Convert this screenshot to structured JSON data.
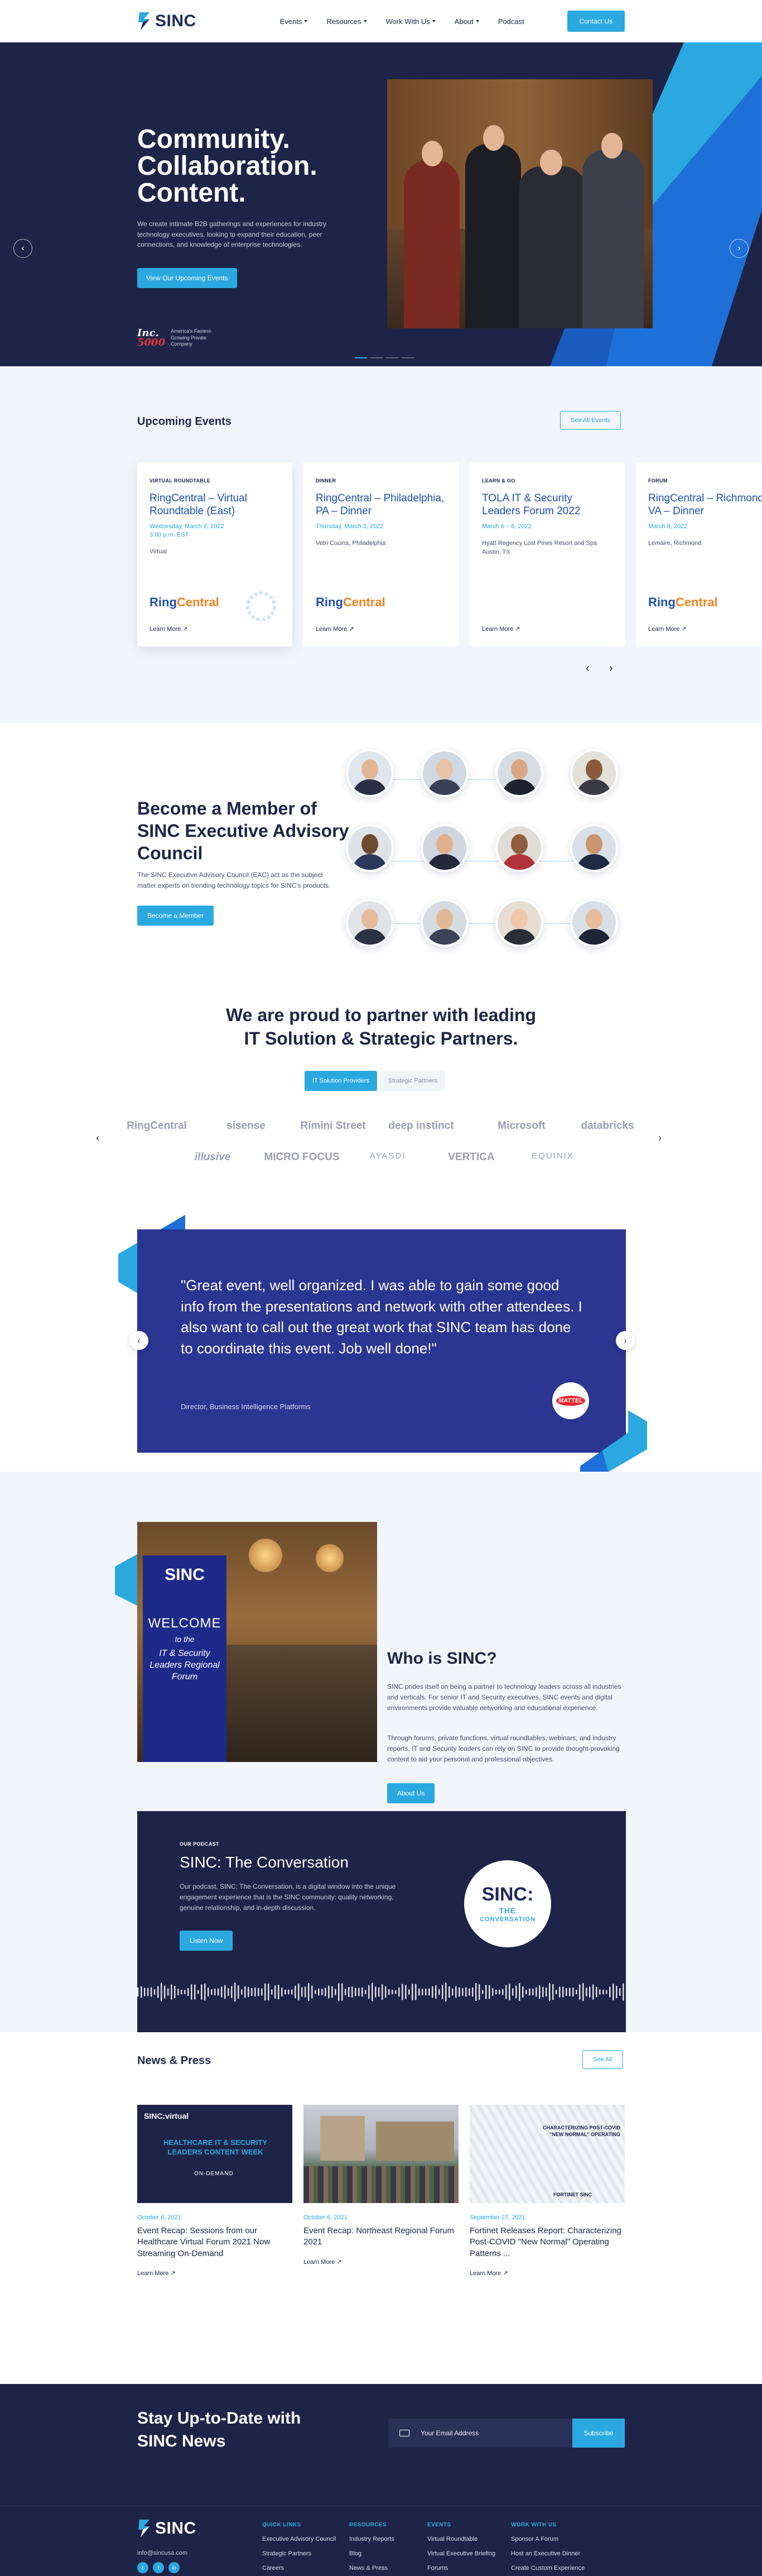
{
  "header": {
    "logo_text": "SINC",
    "nav": [
      "Events",
      "Resources",
      "Work With Us",
      "About",
      "Podcast"
    ],
    "nav_has_caret": [
      true,
      true,
      true,
      true,
      false
    ],
    "cta": "Contact Us"
  },
  "hero": {
    "title_lines": [
      "Community.",
      "Collaboration.",
      "Content."
    ],
    "description": "We create intimate B2B gatherings and experiences for industry technology executives, looking to expand their education, peer connections, and knowledge of enterprise technologies.",
    "cta": "View Our Upcoming Events",
    "inc_badge_top": "Inc.",
    "inc_badge_bottom": "5000",
    "inc_text": "America's Fastest-Growing Private Company",
    "slide_count": 4,
    "active_slide": 1
  },
  "events": {
    "title": "Upcoming Events",
    "see_all": "See All Events",
    "cards": [
      {
        "type": "VIRTUAL ROUNDTABLE",
        "name": "RingCentral – Virtual Roundtable (East)",
        "date": "Wednesday, March 2, 2022\n3:00 p.m. EST",
        "location": "Virtual",
        "brand": "RingCentral",
        "more": "Learn More"
      },
      {
        "type": "DINNER",
        "name": "RingCentral – Philadelphia, PA – Dinner",
        "date": "Thursday, March 3, 2022",
        "location": "Vetri Cucina, Philadelphia",
        "brand": "RingCentral",
        "more": "Learn More"
      },
      {
        "type": "LEARN & GO",
        "name": "TOLA IT & Security Leaders Forum 2022",
        "date": "March 6 – 8, 2022",
        "location": "Hyatt Regency Lost Pines Resort and Spa\nAustin, TX",
        "brand": "",
        "more": "Learn More"
      },
      {
        "type": "FORUM",
        "name": "RingCentral – Richmond, VA – Dinner",
        "date": "March 8, 2022",
        "location": "Lemaire, Richmond",
        "brand": "RingCentral",
        "more": "Learn More"
      }
    ]
  },
  "member": {
    "title": "Become a Member of SINC Executive Advisory Council",
    "description": "The SINC Executive Advisory Council (EAC) act as the subject matter experts on trending technology topics for SINC's products.",
    "cta": "Become a Member"
  },
  "partners": {
    "title_line1": "We are proud to partner with leading",
    "title_line2": "IT Solution & Strategic Partners.",
    "tabs": [
      "IT Solution Providers",
      "Strategic Partners"
    ],
    "row1": [
      "RingCentral",
      "sisense",
      "Rimini Street",
      "deep instinct",
      "Microsoft",
      "databricks"
    ],
    "row2": [
      "illusive",
      "MICRO FOCUS",
      "AYASDI",
      "VERTICA",
      "EQUINIX"
    ]
  },
  "testimonial": {
    "quote": "\"Great event, well organized. I was able to gain some good info from the presentations and network with other attendees. I also want to call out the great work that SINC team has done to coordinate this event. Job well done!\"",
    "role": "Director, Business Intelligence Platforms",
    "company_logo": "MATTEL"
  },
  "who": {
    "title": "Who is SINC?",
    "p1": "SINC prides itself on being a partner to technology leaders across all industries and verticals. For senior IT and Security executives, SINC events and digital environments provide valuable networking and educational experience.",
    "p2": "Through forums, private functions, virtual roundtables, webinars, and industry reports, IT and Security leaders can rely on SINC to provide thought-provoking content to aid your personal and professional objectives.",
    "cta": "About Us",
    "banner_logo": "SINC",
    "banner_welcome": "WELCOME",
    "banner_sub": "to the",
    "banner_forum": "IT & Security Leaders Regional Forum"
  },
  "podcast": {
    "kicker": "OUR PODCAST",
    "title": "SINC: The Conversation",
    "description": "Our podcast, SINC: The Conversation, is a digital window into the unique engagement experience that is the SINC community: quality networking, genuine relationship, and in-depth discussion.",
    "cta": "Listen Now",
    "badge_top": "SINC:",
    "badge_mid": "THE",
    "badge_bottom": "CONVERSATION"
  },
  "news": {
    "title": "News & Press",
    "see_all": "See All",
    "items": [
      {
        "date": "October 6, 2021",
        "title": "Event Recap: Sessions from our Healthcare Virtual Forum 2021 Now Streaming On-Demand",
        "more": "Learn More",
        "img_label": "SINC:virtual",
        "img_headline": "HEALTHCARE IT & SECURITY LEADERS CONTENT WEEK",
        "img_tag": "ON-DEMAND"
      },
      {
        "date": "October 6, 2021",
        "title": "Event Recap: Northeast Regional Forum 2021",
        "more": "Learn More"
      },
      {
        "date": "September 27, 2021",
        "title": "Fortinet Releases Report: Characterizing Post-COVID \"New Normal\" Operating Patterns ...",
        "more": "Learn More",
        "img_headline": "CHARACTERIZING POST-COVID \"NEW NORMAL\" OPERATING",
        "img_brands": "FORTINET  SINC"
      }
    ]
  },
  "newsletter": {
    "title": "Stay Up-to-Date with SINC News",
    "placeholder": "Your Email Address",
    "cta": "Subscribe"
  },
  "footer": {
    "logo_text": "SINC",
    "email": "info@sincusa.com",
    "social": [
      "t",
      "f",
      "in"
    ],
    "columns": [
      {
        "head": "QUICK LINKS",
        "links": [
          "Executive Advisory Council",
          "Strategic Partners",
          "Careers"
        ]
      },
      {
        "head": "RESOURCES",
        "links": [
          "Industry Reports",
          "Blog",
          "News & Press"
        ]
      },
      {
        "head": "EVENTS",
        "links": [
          "Virtual Roundtable",
          "Virtual Executive Briefing",
          "Forums"
        ]
      },
      {
        "head": "WORK WITH US",
        "links": [
          "Sponsor A Forum",
          "Host an Executive Dinner",
          "Create Custom Experience"
        ]
      }
    ]
  },
  "colors": {
    "navy": "#1e2447",
    "accent": "#2ba8e0",
    "card_blue": "#2b3592",
    "ringcentral_orange": "#f58220"
  }
}
